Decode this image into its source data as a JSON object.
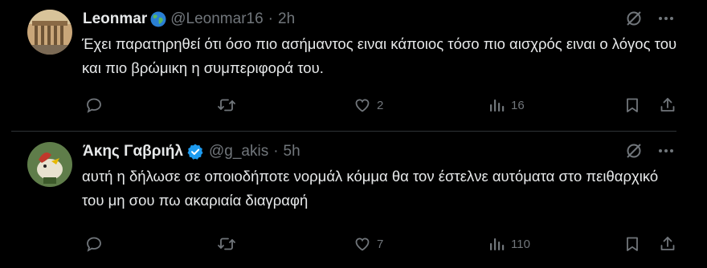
{
  "tweets": [
    {
      "name": "Leonmar",
      "name_emoji": "globe-icon",
      "verified": false,
      "handle": "@Leonmar16",
      "separator": "·",
      "time": "2h",
      "text": "Έχει παρατηρηθεί ότι όσο πιο ασήμαντος ειναι κάποιος τόσο πιο αισχρός ειναι ο λόγος του και πιο βρώμικη η συμπεριφορά του.",
      "replies": "",
      "retweets": "",
      "likes": "2",
      "views": "16"
    },
    {
      "name": "Άκης Γαβριήλ",
      "verified": true,
      "handle": "@g_akis",
      "separator": "·",
      "time": "5h",
      "text": "αυτή η δήλωσε σε οποιοδήποτε νορμάλ κόμμα θα τον έστελνε αυτόματα στο πειθαρχικό του μη σου πω ακαριαία διαγραφή",
      "replies": "",
      "retweets": "",
      "likes": "7",
      "views": "110"
    }
  ],
  "colors": {
    "background": "#000000",
    "text": "#e7e9ea",
    "secondary": "#71767b",
    "divider": "#2f3336",
    "verified": "#1d9bf0"
  }
}
